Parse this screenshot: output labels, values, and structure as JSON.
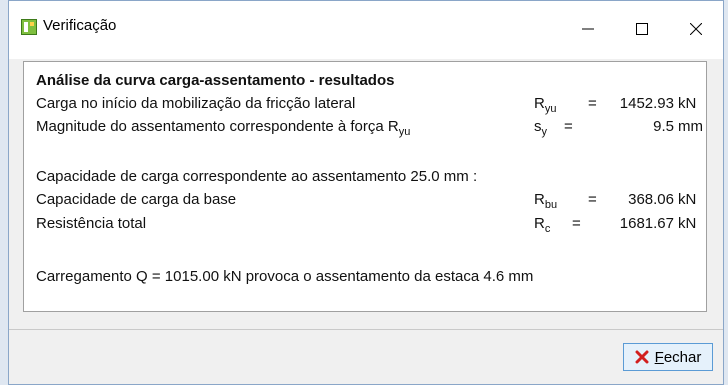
{
  "window": {
    "title": "Verificação"
  },
  "results": {
    "heading": "Análise da curva carga-assentamento - resultados",
    "row1": {
      "label": "Carga no início da mobilização da fricção lateral",
      "sym": "R",
      "sub": "yu",
      "eq": "=",
      "value": "1452.93",
      "unit": "kN"
    },
    "row2": {
      "label": "Magnitude do assentamento correspondente à força R",
      "label_sub": "yu",
      "sym": "s",
      "sub": "y",
      "eq": "=",
      "value": "9.5",
      "unit": "mm"
    },
    "section2": "Capacidade de carga correspondente ao assentamento 25.0 mm :",
    "row3": {
      "label": "Capacidade de carga da base",
      "sym": "R",
      "sub": "bu",
      "eq": "=",
      "value": "368.06",
      "unit": "kN"
    },
    "row4": {
      "label": "Resistência total",
      "sym": "R",
      "sub": "c",
      "eq": "=",
      "value": "1681.67",
      "unit": "kN"
    },
    "summary": "Carregamento Q = 1015.00 kN provoca o assentamento da estaca 4.6 mm"
  },
  "buttons": {
    "close_first": "F",
    "close_rest": "echar"
  },
  "icons": {
    "app": "app-window-icon",
    "close": "close-red-x-icon"
  }
}
